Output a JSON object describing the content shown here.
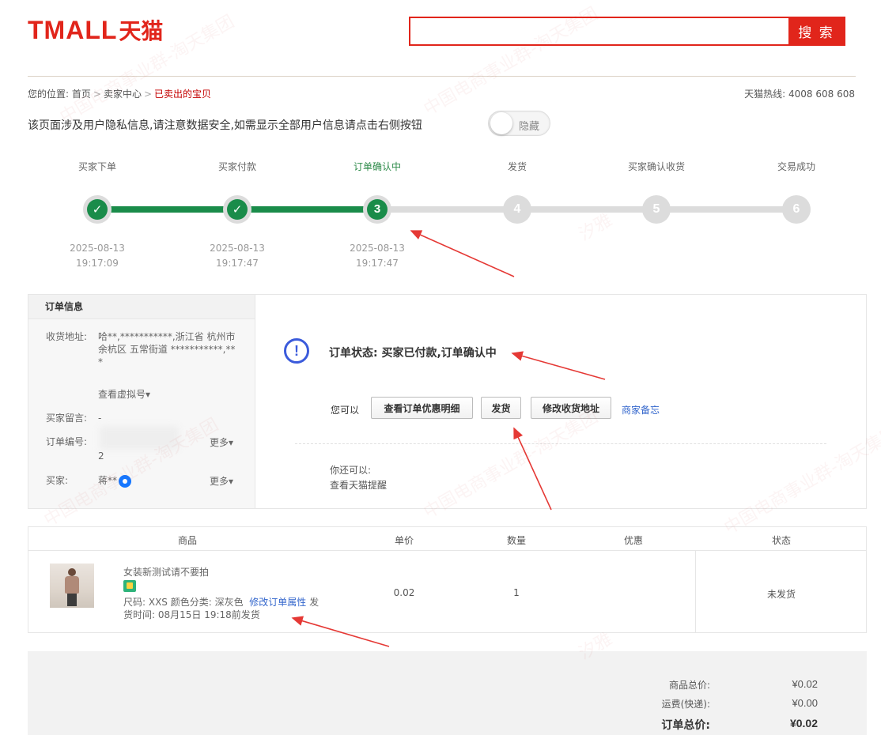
{
  "header": {
    "logo_latin": "TMALL",
    "logo_cn": "天猫",
    "search_placeholder": "",
    "search_button": "搜 索"
  },
  "breadcrumb": {
    "prefix": "您的位置:",
    "items": [
      "首页",
      "卖家中心",
      "已卖出的宝贝"
    ],
    "separator": ">",
    "hotline": "天猫热线: 4008 608 608"
  },
  "privacy": {
    "notice": "该页面涉及用户隐私信息,请注意数据安全,如需显示全部用户信息请点击右侧按钮",
    "toggle_label": "隐藏",
    "toggle_on": false
  },
  "steps": [
    {
      "label": "买家下单",
      "number": "1",
      "state": "done",
      "date": "2025-08-13",
      "time": "19:17:09"
    },
    {
      "label": "买家付款",
      "number": "2",
      "state": "done",
      "date": "2025-08-13",
      "time": "19:17:47"
    },
    {
      "label": "订单确认中",
      "number": "3",
      "state": "current",
      "date": "2025-08-13",
      "time": "19:17:47"
    },
    {
      "label": "发货",
      "number": "4",
      "state": "todo",
      "date": "",
      "time": ""
    },
    {
      "label": "买家确认收货",
      "number": "5",
      "state": "todo",
      "date": "",
      "time": ""
    },
    {
      "label": "交易成功",
      "number": "6",
      "state": "todo",
      "date": "",
      "time": ""
    }
  ],
  "order_info": {
    "title": "订单信息",
    "address_label": "收货地址:",
    "address_value": "哈**,***********,浙江省 杭州市 余杭区 五常街道 ***********,***",
    "virtual_number_link": "查看虚拟号▾",
    "message_label": "买家留言:",
    "message_value": "-",
    "order_no_label": "订单编号:",
    "order_no_tail": "2",
    "buyer_label": "买家:",
    "buyer_value": "蒋**",
    "more_label": "更多▾"
  },
  "status": {
    "icon": "exclamation-circle-icon",
    "text": "订单状态: 买家已付款,订单确认中",
    "you_can_label": "您可以",
    "buttons": [
      "查看订单优惠明细",
      "发货",
      "修改收货地址"
    ],
    "merchant_note_link": "商家备忘",
    "also_label": "你还可以:",
    "also_link": "查看天猫提醒"
  },
  "product_table": {
    "headers": [
      "商品",
      "单价",
      "数量",
      "优惠",
      "状态"
    ],
    "rows": [
      {
        "name": "女装新测试请不要拍",
        "attr_prefix": "尺码: XXS 颜色分类: 深灰色",
        "modify_link": "修改订单属性",
        "ship_time": "发货时间: 08月15日 19:18前发货",
        "price": "0.02",
        "quantity": "1",
        "discount": "",
        "status": "未发货"
      }
    ]
  },
  "totals": {
    "goods_label": "商品总价:",
    "goods_value": "¥0.02",
    "shipping_label": "运费(快递):",
    "shipping_value": "¥0.00",
    "total_label": "订单总价:",
    "total_value": "¥0.02"
  },
  "watermark": "中国电商事业群-淘天集团",
  "watermark_name": "汐雅",
  "colors": {
    "brand": "#e1251b",
    "done": "#1a8c4a",
    "link": "#3366cc",
    "annotation": "#e53935"
  }
}
